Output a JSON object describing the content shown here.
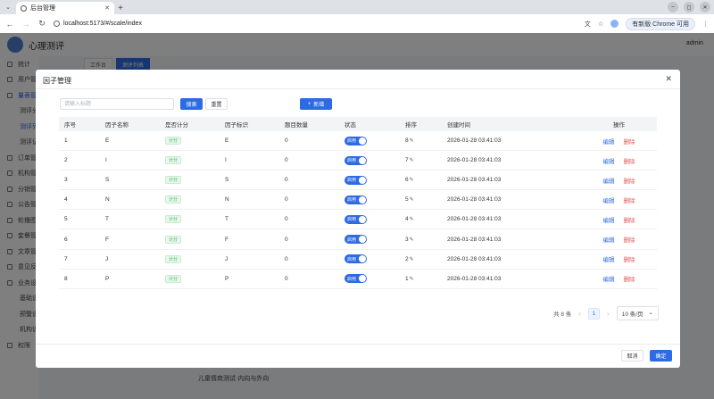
{
  "browser": {
    "tab_title": "后台管理",
    "url": "localhost:5173/#/scale/index",
    "chrome_update_label": "有新版 Chrome 可用"
  },
  "app": {
    "title": "心理测评",
    "user": "admin",
    "sidebar": [
      {
        "label": "统计"
      },
      {
        "label": "用户管"
      },
      {
        "label": "量表管"
      },
      {
        "label": "测评分"
      },
      {
        "label": "测评列"
      },
      {
        "label": "测评记"
      },
      {
        "label": "订单管"
      },
      {
        "label": "机构管"
      },
      {
        "label": "分销管"
      },
      {
        "label": "公告管"
      },
      {
        "label": "轮播图"
      },
      {
        "label": "套餐管"
      },
      {
        "label": "文章管"
      },
      {
        "label": "意见反"
      },
      {
        "label": "业务设"
      },
      {
        "label": "基础设"
      },
      {
        "label": "预警设"
      },
      {
        "label": "机构设"
      },
      {
        "label": "权限"
      }
    ],
    "tabs": [
      "工作台",
      "测评列表"
    ],
    "bg_text": "儿童情商测试·内向与外向"
  },
  "modal": {
    "title": "因子管理",
    "search_placeholder": "请输入标题",
    "search_label": "搜索",
    "reset_label": "重置",
    "add_label": "新增",
    "columns": [
      "序号",
      "因子名称",
      "是否计分",
      "因子标识",
      "题目数量",
      "状态",
      "排序",
      "创建时间",
      "操作"
    ],
    "rows": [
      {
        "no": "1",
        "name": "E",
        "scored": "计分",
        "key": "E",
        "count": "0",
        "status": "启用",
        "sort": "8",
        "created": "2026-01-28 03:41:03"
      },
      {
        "no": "2",
        "name": "I",
        "scored": "计分",
        "key": "I",
        "count": "0",
        "status": "启用",
        "sort": "7",
        "created": "2026-01-28 03:41:03"
      },
      {
        "no": "3",
        "name": "S",
        "scored": "计分",
        "key": "S",
        "count": "0",
        "status": "启用",
        "sort": "6",
        "created": "2026-01-28 03:41:03"
      },
      {
        "no": "4",
        "name": "N",
        "scored": "计分",
        "key": "N",
        "count": "0",
        "status": "启用",
        "sort": "5",
        "created": "2026-01-28 03:41:03"
      },
      {
        "no": "5",
        "name": "T",
        "scored": "计分",
        "key": "T",
        "count": "0",
        "status": "启用",
        "sort": "4",
        "created": "2026-01-28 03:41:03"
      },
      {
        "no": "6",
        "name": "F",
        "scored": "计分",
        "key": "F",
        "count": "0",
        "status": "启用",
        "sort": "3",
        "created": "2026-01-28 03:41:03"
      },
      {
        "no": "7",
        "name": "J",
        "scored": "计分",
        "key": "J",
        "count": "0",
        "status": "启用",
        "sort": "2",
        "created": "2026-01-28 03:41:03"
      },
      {
        "no": "8",
        "name": "P",
        "scored": "计分",
        "key": "P",
        "count": "0",
        "status": "启用",
        "sort": "1",
        "created": "2026-01-28 03:41:03"
      }
    ],
    "edit_label": "编辑",
    "delete_label": "删除",
    "pagination": {
      "total": "共 8 条",
      "current": "1",
      "page_size": "10 条/页"
    },
    "cancel_label": "取消",
    "confirm_label": "确定"
  },
  "colors": {
    "primary": "#2d6be4",
    "danger": "#e25555",
    "success": "#3bb55f"
  }
}
